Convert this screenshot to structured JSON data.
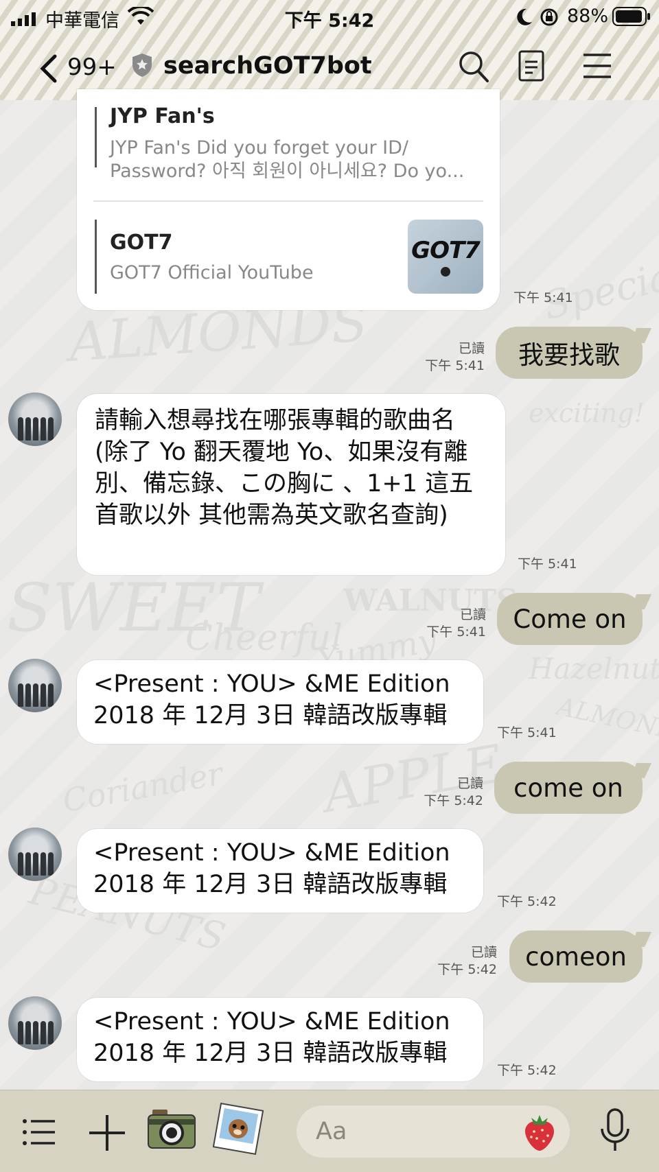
{
  "status_bar": {
    "carrier": "中華電信",
    "time": "下午 5:42",
    "battery": "88%"
  },
  "header": {
    "back_count": "99+",
    "title": "searchGOT7bot"
  },
  "link_card": {
    "items": [
      {
        "title": "JYP Fan's",
        "description": "JYP Fan's Did you forget your ID/ Password? 아직 회원이 아니세요? Do yo..."
      },
      {
        "title": "GOT7",
        "description": "GOT7 Official YouTube",
        "thumbnail_text": "GOT7"
      }
    ],
    "time": "下午 5:41"
  },
  "messages": [
    {
      "from": "me",
      "text": "我要找歌",
      "read": "已讀",
      "time": "下午 5:41"
    },
    {
      "from": "bot",
      "text": "請輸入想尋找在哪張專輯的歌曲名 (除了 Yo 翻天覆地 Yo、如果沒有離別、備忘錄、この胸に 、1+1 這五首歌以外 其他需為英文歌名查詢)",
      "time": "下午 5:41"
    },
    {
      "from": "me",
      "text": "Come on",
      "read": "已讀",
      "time": "下午 5:41"
    },
    {
      "from": "bot",
      "text": "<Present : YOU> &ME Edition 2018 年 12月 3日 韓語改版專輯",
      "time": "下午 5:41"
    },
    {
      "from": "me",
      "text": "come on",
      "read": "已讀",
      "time": "下午 5:42"
    },
    {
      "from": "bot",
      "text": "<Present : YOU> &ME Edition 2018 年 12月 3日 韓語改版專輯",
      "time": "下午 5:42"
    },
    {
      "from": "me",
      "text": "comeon",
      "read": "已讀",
      "time": "下午 5:42"
    },
    {
      "from": "bot",
      "text": "<Present : YOU> &ME Edition 2018 年 12月 3日 韓語改版專輯",
      "time": "下午 5:42"
    }
  ],
  "input": {
    "placeholder": "Aa"
  },
  "background_words": [
    "ALMONDS",
    "SWEET",
    "APPLE",
    "Coriander",
    "WALNUTS",
    "Hazelnuts",
    "Cheerful",
    "exciting!",
    "Yummy",
    "ALMONDS",
    "Special",
    "PEANUTS"
  ],
  "colors": {
    "bubble_out": "#c9c7b1",
    "bubble_in": "#ffffff",
    "toolbar": "#d6d3c3",
    "strawberry": "#d9313c"
  },
  "icons": [
    "chevron-left-icon",
    "shield-star-icon",
    "search-icon",
    "notes-icon",
    "menu-icon",
    "list-icon",
    "plus-icon",
    "camera-icon",
    "sticker-photo-icon",
    "strawberry-emoji-icon",
    "microphone-icon"
  ]
}
